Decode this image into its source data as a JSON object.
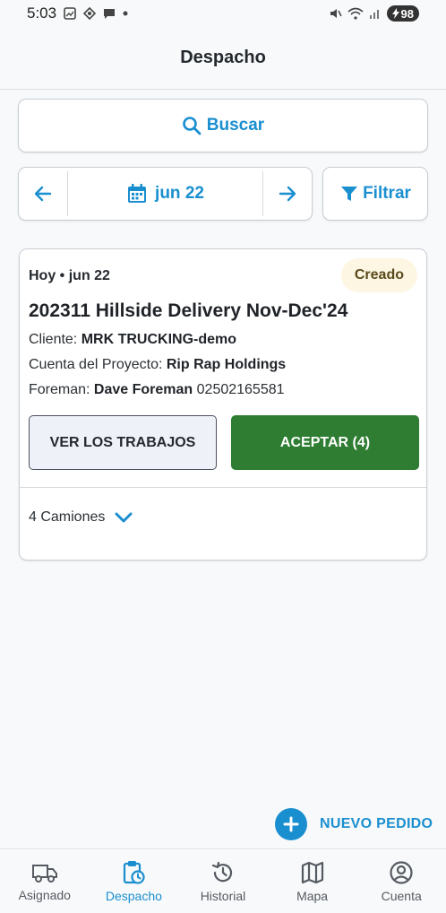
{
  "status_bar": {
    "time": "5:03",
    "battery": "98"
  },
  "appbar": {
    "title": "Despacho"
  },
  "search": {
    "label": "Buscar"
  },
  "date_nav": {
    "date": "jun 22"
  },
  "filter": {
    "label": "Filtrar"
  },
  "order_card": {
    "date_label": "Hoy • jun 22",
    "status": "Creado",
    "title": "202311 Hillside Delivery Nov-Dec'24",
    "client_label": "Cliente:",
    "client_value": "MRK TRUCKING-demo",
    "project_label": "Cuenta del Proyecto:",
    "project_value": "Rip Rap Holdings",
    "foreman_label": "Foreman:",
    "foreman_name": "Dave Foreman",
    "foreman_phone": "02502165581",
    "view_jobs_label": "VER LOS TRABAJOS",
    "accept_label": "ACEPTAR (4)",
    "trucks_label": "4 Camiones"
  },
  "fab": {
    "label": "NUEVO PEDIDO"
  },
  "bottom_nav": {
    "items": [
      {
        "label": "Asignado",
        "icon": "truck-icon"
      },
      {
        "label": "Despacho",
        "icon": "clipboard-clock-icon"
      },
      {
        "label": "Historial",
        "icon": "history-icon"
      },
      {
        "label": "Mapa",
        "icon": "map-icon"
      },
      {
        "label": "Cuenta",
        "icon": "account-icon"
      }
    ],
    "active_index": 1
  },
  "colors": {
    "accent": "#1a8fd0",
    "accept": "#2e7d32",
    "badge_bg": "#fdf6e3"
  }
}
